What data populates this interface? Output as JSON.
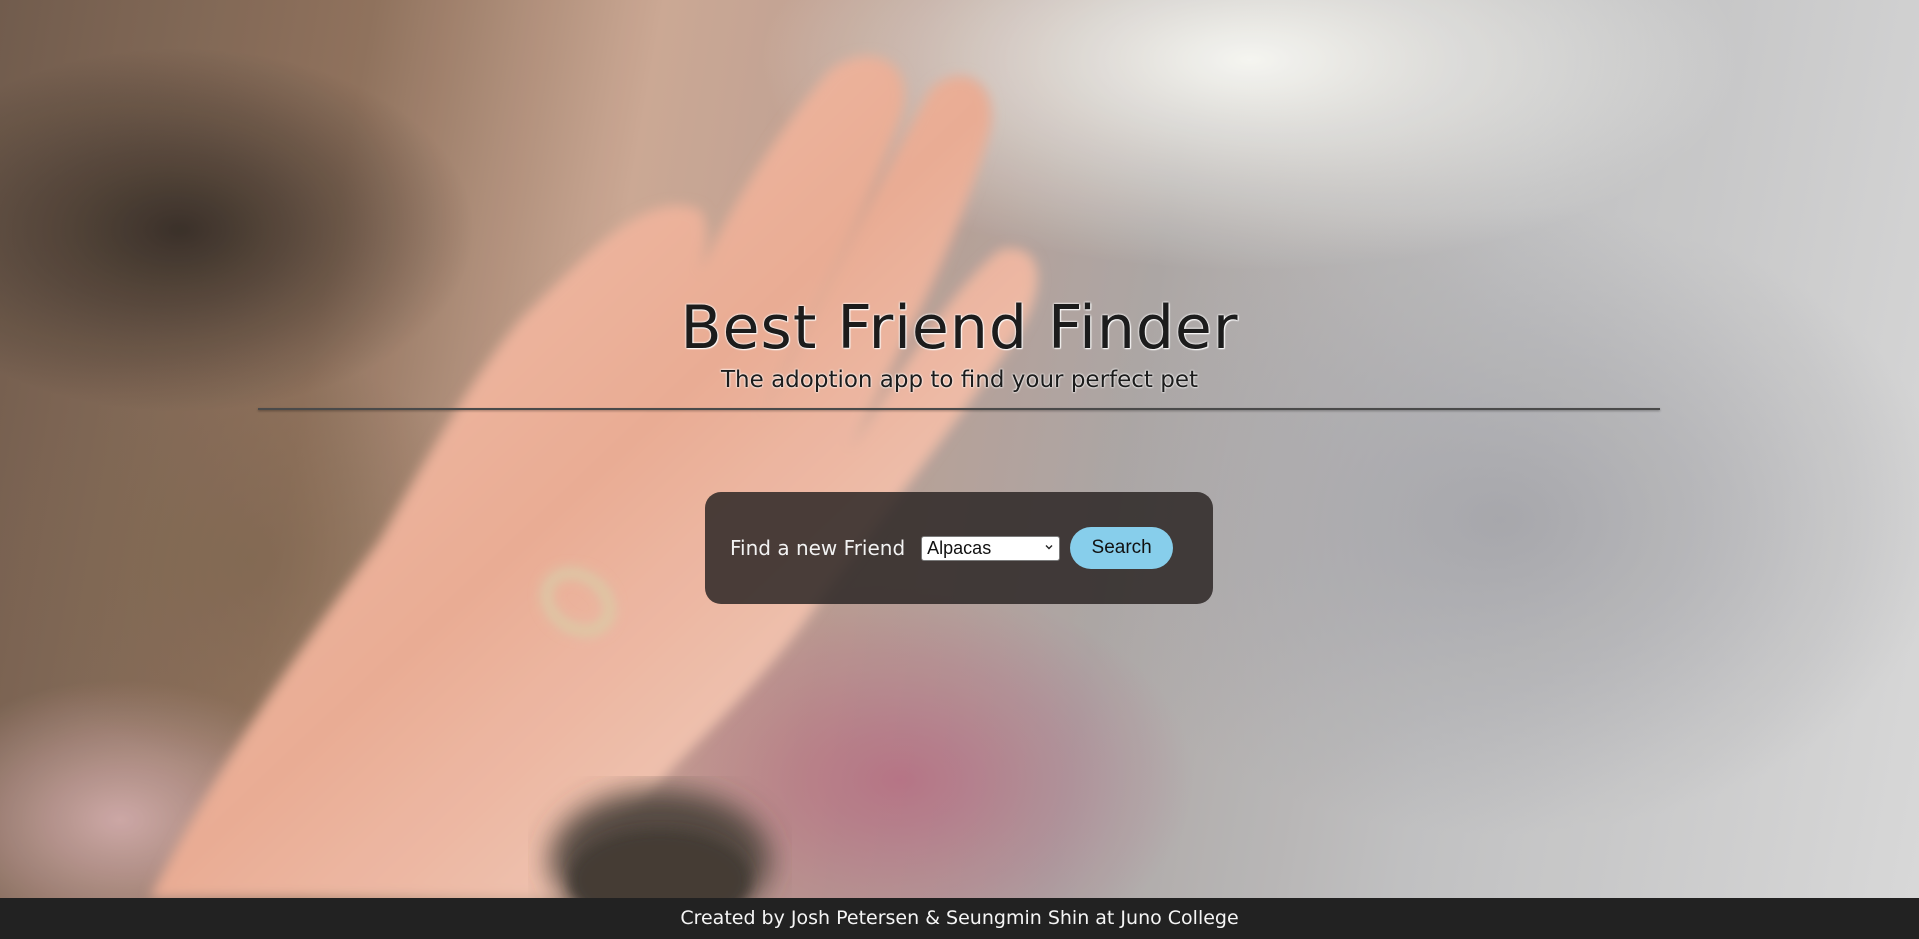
{
  "header": {
    "title": "Best Friend Finder",
    "subtitle": "The adoption app to find your perfect pet"
  },
  "search": {
    "label": "Find a new Friend",
    "selected_animal": "Alpacas",
    "button_label": "Search"
  },
  "footer": {
    "credits": "Created by Josh Petersen & Seungmin Shin at Juno College"
  },
  "colors": {
    "button": "#87ceeb",
    "panel": "#2d2826",
    "footer": "#222222"
  }
}
